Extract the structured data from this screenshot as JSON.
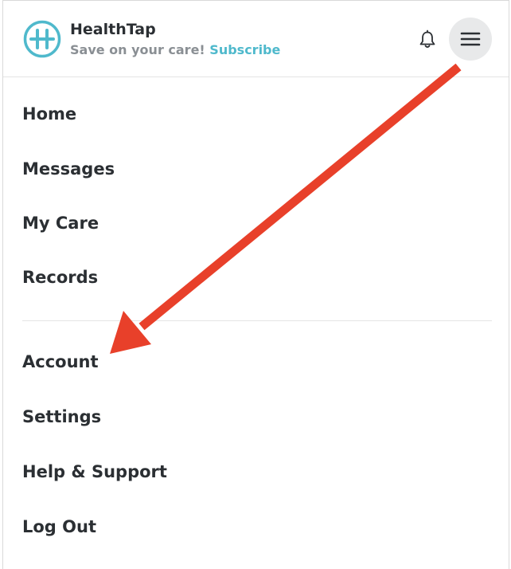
{
  "header": {
    "brand_name": "HealthTap",
    "tagline_prefix": "Save on your care!",
    "subscribe_label": "Subscribe",
    "logo_letter": "H"
  },
  "menu": {
    "primary": [
      {
        "label": "Home"
      },
      {
        "label": "Messages"
      },
      {
        "label": "My Care"
      },
      {
        "label": "Records"
      }
    ],
    "secondary": [
      {
        "label": "Account"
      },
      {
        "label": "Settings"
      },
      {
        "label": "Help & Support"
      },
      {
        "label": "Log Out"
      }
    ]
  },
  "icons": {
    "logo": "healthtap-logo-icon",
    "notifications": "bell-icon",
    "menu": "hamburger-menu-icon",
    "annotation": "red-arrow-annotation"
  },
  "colors": {
    "brand_accent": "#4fb9cc",
    "text_primary": "#2b2f33",
    "text_muted": "#8a8f94",
    "menu_button_bg": "#e8e9ea",
    "annotation_arrow": "#e8402a"
  }
}
